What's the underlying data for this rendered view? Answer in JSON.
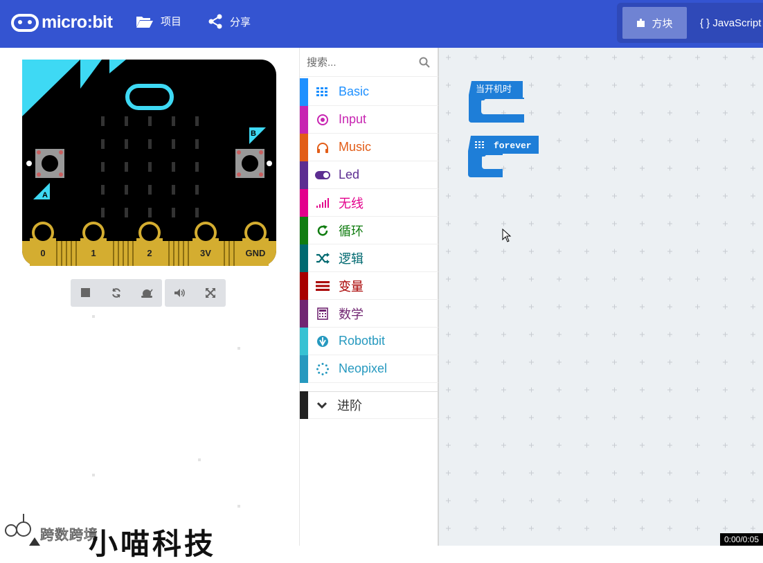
{
  "header": {
    "logo_text": "micro:bit",
    "projects_label": "项目",
    "share_label": "分享",
    "blocks_label": "方块",
    "javascript_label": "{ } JavaScript"
  },
  "simulator": {
    "pins": [
      "0",
      "1",
      "2",
      "3V",
      "GND"
    ],
    "button_a": "A",
    "button_b": "B"
  },
  "toolbox": {
    "search_placeholder": "搜索...",
    "categories": [
      {
        "label": "Basic",
        "color": "#1e90ff",
        "icon": "grid-icon"
      },
      {
        "label": "Input",
        "color": "#c724b1",
        "icon": "target-icon"
      },
      {
        "label": "Music",
        "color": "#e25d18",
        "icon": "headphones-icon"
      },
      {
        "label": "Led",
        "color": "#5c2d91",
        "icon": "toggle-icon"
      },
      {
        "label": "无线",
        "color": "#e3008c",
        "icon": "signal-icon"
      },
      {
        "label": "循环",
        "color": "#107c10",
        "icon": "refresh-icon"
      },
      {
        "label": "逻辑",
        "color": "#006970",
        "icon": "shuffle-icon"
      },
      {
        "label": "变量",
        "color": "#a80000",
        "icon": "lines-icon"
      },
      {
        "label": "数学",
        "color": "#712672",
        "icon": "calculator-icon"
      },
      {
        "label": "Robotbit",
        "color": "#36c2d3",
        "icon": "rebel-icon"
      },
      {
        "label": "Neopixel",
        "color": "#2699bf",
        "icon": "circle-dots-icon"
      }
    ],
    "advanced_label": "进阶"
  },
  "workspace": {
    "block_on_start": "当开机时",
    "block_forever": "forever",
    "block_color": "#1e7ed8"
  },
  "watermark": {
    "small_text": "跨数跨境",
    "big_text": "小喵科技"
  },
  "video_time": "0:00/0:05"
}
